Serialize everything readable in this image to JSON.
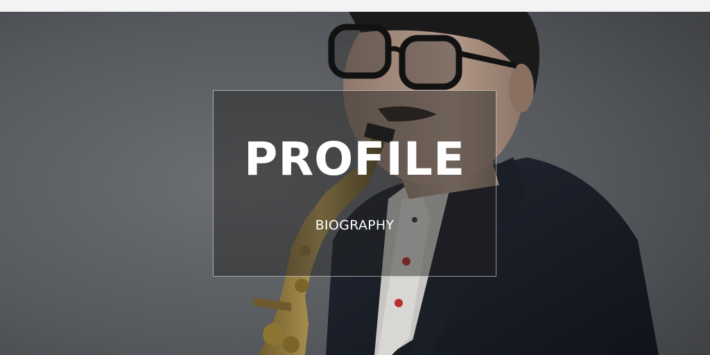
{
  "hero": {
    "title": "PROFILE",
    "subtitle": "BIOGRAPHY",
    "image": "portrait-photo-saxophonist"
  },
  "colors": {
    "top_bar": "#f3f3f3",
    "backdrop": "#55585b",
    "title_text": "#ffffff",
    "box_border": "#ffffff"
  }
}
